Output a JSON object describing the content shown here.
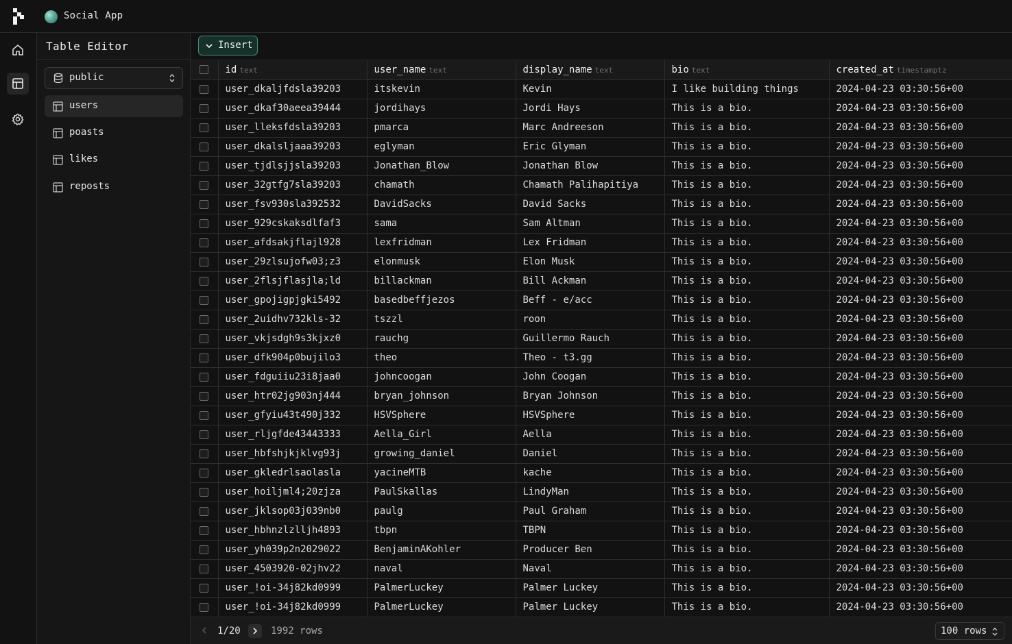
{
  "app": {
    "project_name": "Social App",
    "section_title": "Table Editor"
  },
  "nav": {
    "icons": [
      "home-icon",
      "table-editor-icon",
      "settings-icon"
    ],
    "active": "table-editor-icon"
  },
  "sidebar": {
    "schema": "public",
    "tables": [
      {
        "label": "users",
        "active": true
      },
      {
        "label": "poasts",
        "active": false
      },
      {
        "label": "likes",
        "active": false
      },
      {
        "label": "reposts",
        "active": false
      }
    ]
  },
  "toolbar": {
    "insert_label": "Insert"
  },
  "grid": {
    "columns": [
      {
        "name": "id",
        "type": "text"
      },
      {
        "name": "user_name",
        "type": "text"
      },
      {
        "name": "display_name",
        "type": "text"
      },
      {
        "name": "bio",
        "type": "text"
      },
      {
        "name": "created_at",
        "type": "timestamptz"
      }
    ],
    "rows": [
      [
        "user_dkaljfdsla39203",
        "itskevin",
        "Kevin",
        "I like building things",
        "2024-04-23 03:30:56+00"
      ],
      [
        "user_dkaf30aeea39444",
        "jordihays",
        "Jordi Hays",
        "This is a bio.",
        "2024-04-23 03:30:56+00"
      ],
      [
        "user_lleksfdsla39203",
        "pmarca",
        "Marc Andreeson",
        "This is a bio.",
        "2024-04-23 03:30:56+00"
      ],
      [
        "user_dkalsljaaa39203",
        "eglyman",
        "Eric Glyman",
        "This is a bio.",
        "2024-04-23 03:30:56+00"
      ],
      [
        "user_tjdlsjjsla39203",
        "Jonathan_Blow",
        "Jonathan Blow",
        "This is a bio.",
        "2024-04-23 03:30:56+00"
      ],
      [
        "user_32gtfg7sla39203",
        "chamath",
        "Chamath Palihapitiya",
        "This is a bio.",
        "2024-04-23 03:30:56+00"
      ],
      [
        "user_fsv930sla392532",
        "DavidSacks",
        "David Sacks",
        "This is a bio.",
        "2024-04-23 03:30:56+00"
      ],
      [
        "user_929cskaksdlfaf3",
        "sama",
        "Sam Altman",
        "This is a bio.",
        "2024-04-23 03:30:56+00"
      ],
      [
        "user_afdsakjflajl928",
        "lexfridman",
        "Lex Fridman",
        "This is a bio.",
        "2024-04-23 03:30:56+00"
      ],
      [
        "user_29zlsujofw03;z3",
        "elonmusk",
        "Elon Musk",
        "This is a bio.",
        "2024-04-23 03:30:56+00"
      ],
      [
        "user_2flsjflasjla;ld",
        "billackman",
        "Bill Ackman",
        "This is a bio.",
        "2024-04-23 03:30:56+00"
      ],
      [
        "user_gpojigpjgki5492",
        "basedbeffjezos",
        "Beff - e/acc",
        "This is a bio.",
        "2024-04-23 03:30:56+00"
      ],
      [
        "user_2uidhv732kls-32",
        "tszzl",
        "roon",
        "This is a bio.",
        "2024-04-23 03:30:56+00"
      ],
      [
        "user_vkjsdgh9s3kjxz0",
        "rauchg",
        "Guillermo Rauch",
        "This is a bio.",
        "2024-04-23 03:30:56+00"
      ],
      [
        "user_dfk904p0bujilo3",
        "theo",
        "Theo - t3.gg",
        "This is a bio.",
        "2024-04-23 03:30:56+00"
      ],
      [
        "user_fdguiiu23i8jaa0",
        "johncoogan",
        "John Coogan",
        "This is a bio.",
        "2024-04-23 03:30:56+00"
      ],
      [
        "user_htr02jg903nj444",
        "bryan_johnson",
        "Bryan Johnson",
        "This is a bio.",
        "2024-04-23 03:30:56+00"
      ],
      [
        "user_gfyiu43t490j332",
        "HSVSphere",
        "HSVSphere",
        "This is a bio.",
        "2024-04-23 03:30:56+00"
      ],
      [
        "user_rljgfde43443333",
        "Aella_Girl",
        "Aella",
        "This is a bio.",
        "2024-04-23 03:30:56+00"
      ],
      [
        "user_hbfshjkjklvg93j",
        "growing_daniel",
        "Daniel",
        "This is a bio.",
        "2024-04-23 03:30:56+00"
      ],
      [
        "user_gkledrlsaolasla",
        "yacineMTB",
        "kache",
        "This is a bio.",
        "2024-04-23 03:30:56+00"
      ],
      [
        "user_hoiljml4;20zjza",
        "PaulSkallas",
        "LindyMan",
        "This is a bio.",
        "2024-04-23 03:30:56+00"
      ],
      [
        "user_jklsop03j039nb0",
        "paulg",
        "Paul Graham",
        "This is a bio.",
        "2024-04-23 03:30:56+00"
      ],
      [
        "user_hbhnzlzlljh4893",
        "tbpn",
        "TBPN",
        "This is a bio.",
        "2024-04-23 03:30:56+00"
      ],
      [
        "user_yh039p2n2029022",
        "BenjaminAKohler",
        "Producer Ben",
        "This is a bio.",
        "2024-04-23 03:30:56+00"
      ],
      [
        "user_4503920-02jhv22",
        "naval",
        "Naval",
        "This is a bio.",
        "2024-04-23 03:30:56+00"
      ],
      [
        "user_!oi-34j82kd0999",
        "PalmerLuckey",
        "Palmer Luckey",
        "This is a bio.",
        "2024-04-23 03:30:56+00"
      ],
      [
        "user_!oi-34j82kd0999",
        "PalmerLuckey",
        "Palmer Luckey",
        "This is a bio.",
        "2024-04-23 03:30:56+00"
      ]
    ]
  },
  "footer": {
    "page_label": "1/20",
    "row_count": "1992 rows",
    "page_size": "100 rows"
  },
  "colors": {
    "background": "#121212",
    "sidebar": "#161616",
    "accent_border": "#3e8e78",
    "accent_fill": "#173029"
  }
}
